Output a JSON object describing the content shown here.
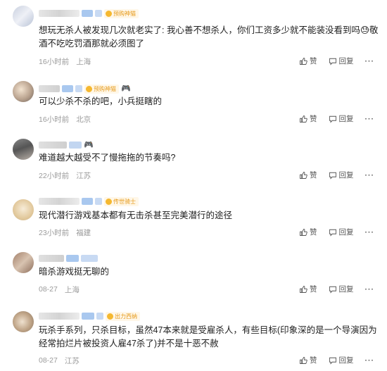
{
  "icons": {
    "like": "thumbs-up-icon",
    "reply": "chat-bubble-icon",
    "more": "more-dots-icon"
  },
  "comments": [
    {
      "badge": "预购神猫",
      "text": "想玩无杀人被发现几次就老实了: 我心善不想杀人，你们工资多少就不能装没看到吗😓敬酒不吃吃罚酒那就必须图了",
      "time": "16小时前",
      "location": "上海",
      "like": "赞",
      "reply": "回复",
      "more": "···"
    },
    {
      "badge": "预购神猫",
      "emoji": "🎮",
      "text": "可以少杀不杀的吧，小兵挺瞎的",
      "time": "16小时前",
      "location": "北京",
      "like": "赞",
      "reply": "回复",
      "more": "···"
    },
    {
      "emoji": "🎮",
      "text": "难道越大越受不了慢拖拖的节奏吗?",
      "time": "22小时前",
      "location": "江苏",
      "like": "赞",
      "reply": "回复",
      "more": "···"
    },
    {
      "badge": "传世骑士",
      "text": "现代潜行游戏基本都有无击杀甚至完美潜行的途径",
      "time": "23小时前",
      "location": "福建",
      "like": "赞",
      "reply": "回复",
      "more": "···"
    },
    {
      "text": "暗杀游戏挺无聊的",
      "time": "08-27",
      "location": "上海",
      "like": "赞",
      "reply": "回复",
      "more": "···"
    },
    {
      "badge": "出力西纳",
      "text": "玩杀手系列，只杀目标，虽然47本来就是受雇杀人，有些目标(印象深的是一个导演因为经常拍烂片被投资人雇47杀了)并不是十恶不赦",
      "time": "08-27",
      "location": "江苏",
      "like": "赞",
      "reply": "回复",
      "more": "···"
    }
  ]
}
